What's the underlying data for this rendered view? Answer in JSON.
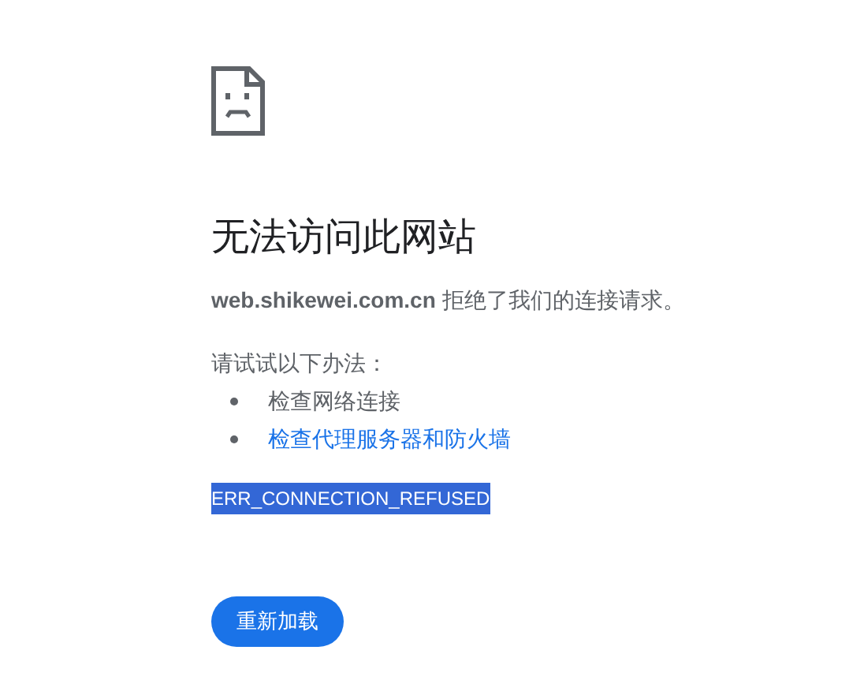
{
  "title": "无法访问此网站",
  "message": "**web.shikewei.com.cn** 拒绝了我们的连接请求。",
  "suggestions_heading": "请试试以下办法：",
  "suggestions": [
    {
      "kind": "text",
      "label": "检查网络连接"
    },
    {
      "kind": "link",
      "label": "检查代理服务器和防火墙"
    }
  ],
  "error_code": {
    "text": "ERR_CONNECTION_REFUSED",
    "selected": true
  },
  "reload_button": "重新加载"
}
